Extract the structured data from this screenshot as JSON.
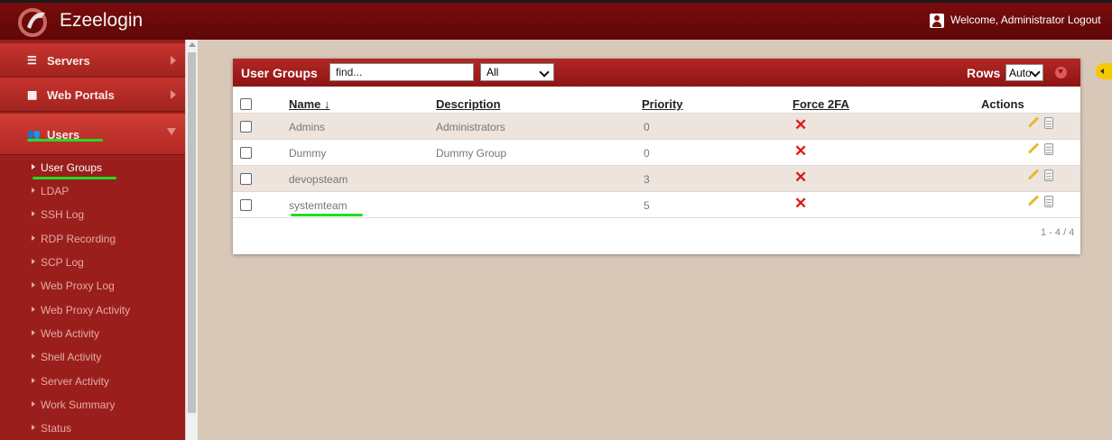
{
  "app": {
    "brand": "Ezeelogin",
    "welcome": "Welcome, Administrator Logout"
  },
  "sidebar": {
    "main_items": [
      {
        "label": "Servers",
        "icon": "list-icon"
      },
      {
        "label": "Web Portals",
        "icon": "grid-icon"
      },
      {
        "label": "Users",
        "icon": "users-icon"
      }
    ],
    "sub_items": [
      {
        "label": "User Groups",
        "active": true
      },
      {
        "label": "LDAP"
      },
      {
        "label": "SSH Log"
      },
      {
        "label": "RDP Recording"
      },
      {
        "label": "SCP Log"
      },
      {
        "label": "Web Proxy Log"
      },
      {
        "label": "Web Proxy Activity"
      },
      {
        "label": "Web Activity"
      },
      {
        "label": "Shell Activity"
      },
      {
        "label": "Server Activity"
      },
      {
        "label": "Work Summary"
      },
      {
        "label": "Status"
      }
    ]
  },
  "panel": {
    "title": "User Groups",
    "search_value": "find...",
    "filter_value": "All",
    "rows_label": "Rows",
    "rows_value": "Auto",
    "columns": [
      "Name",
      "Description",
      "Priority",
      "Force 2FA",
      "Actions"
    ],
    "rows": [
      {
        "name": "Admins",
        "description": "Administrators",
        "priority": "0",
        "force_2fa": "✕"
      },
      {
        "name": "Dummy",
        "description": "Dummy Group",
        "priority": "0",
        "force_2fa": "✕"
      },
      {
        "name": "devopsteam",
        "description": "",
        "priority": "3",
        "force_2fa": "✕"
      },
      {
        "name": "systemteam",
        "description": "",
        "priority": "5",
        "force_2fa": "✕"
      }
    ],
    "pager": "1 - 4 / 4"
  },
  "colors": {
    "topbar": "#6b0a0a",
    "sidebar": "#9a1f1c",
    "panel_header": "#a11f1e",
    "highlight": "#22dd22",
    "x_mark": "#e01818"
  }
}
